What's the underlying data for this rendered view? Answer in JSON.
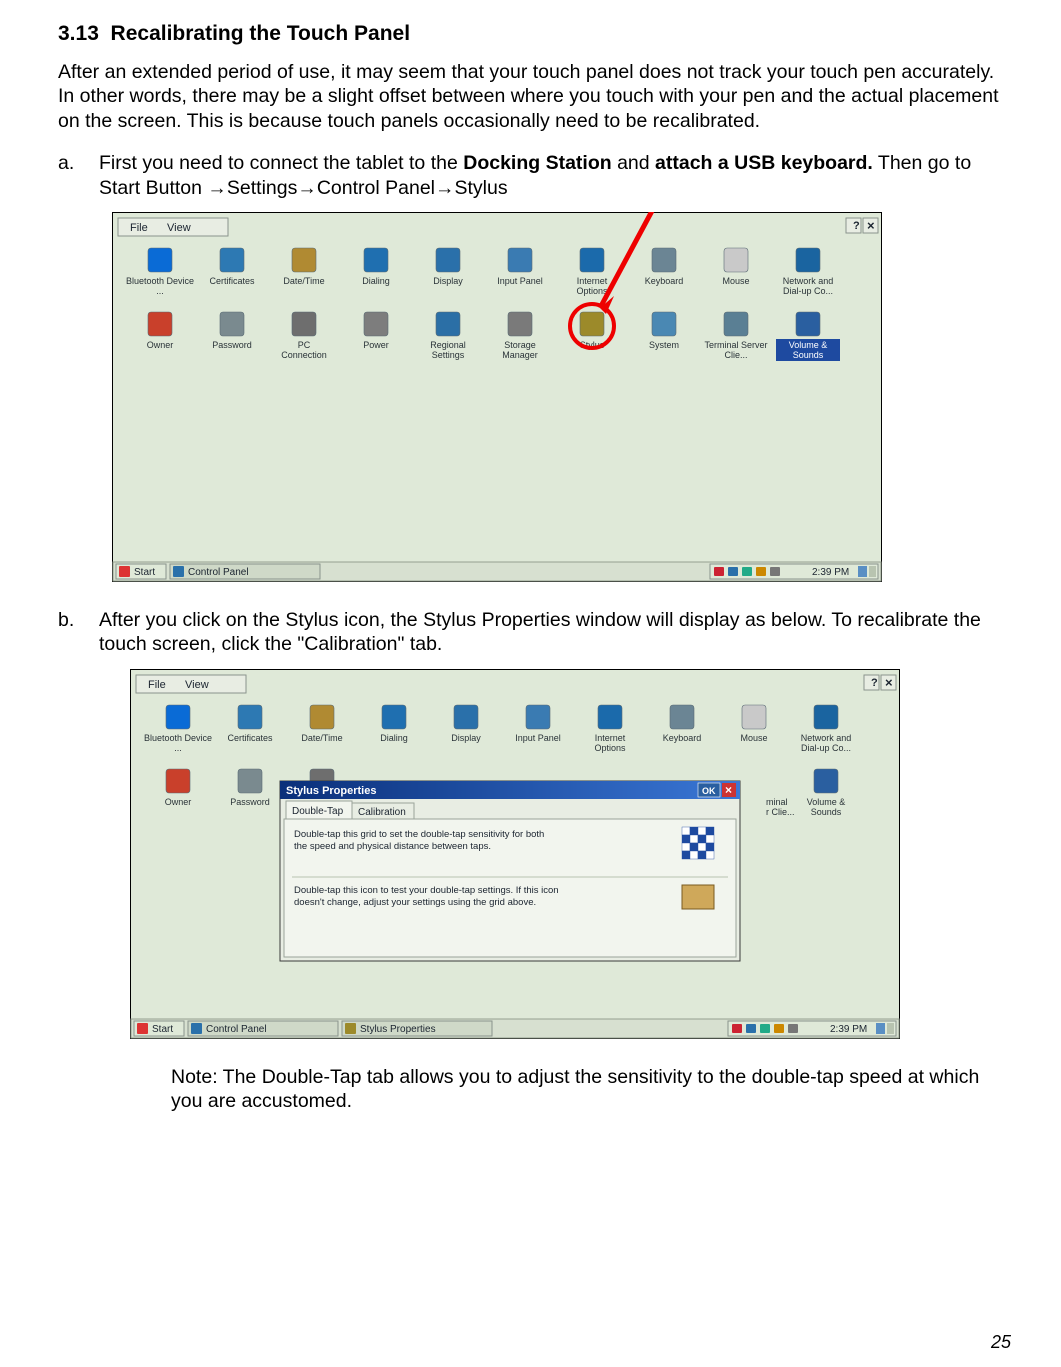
{
  "section_number": "3.13",
  "section_title": "Recalibrating the Touch Panel",
  "intro": "After an extended period of use, it may seem that your touch panel does not track your touch pen accurately.  In other words, there may be a slight offset between where you touch with your pen and the actual placement on the screen.  This is because touch panels occasionally need to be recalibrated.",
  "step_a_marker": "a.",
  "step_a_prefix": "First you need to connect the tablet to the ",
  "step_a_bold1": "Docking Station",
  "step_a_mid": " and ",
  "step_a_bold2": "attach a USB keyboard.",
  "step_a_suffix": "  Then go to Start Button →Settings→Control Panel→Stylus",
  "step_b_marker": "b.",
  "step_b_text": "After you click on the Stylus icon, the Stylus Properties window will display as below.  To recalibrate the touch screen, click the \"Calibration\" tab.",
  "note_text": "Note: The Double-Tap tab allows you to adjust the sensitivity to the double-tap speed at which you are accustomed.",
  "page_number": "25",
  "screenshot1": {
    "menu_file": "File",
    "menu_view": "View",
    "help_glyph": "?",
    "close_glyph": "×",
    "icons_row1": [
      {
        "name": "bluetooth-icon",
        "label": "Bluetooth Device ...",
        "c": "#0a6bd6"
      },
      {
        "name": "certificates-icon",
        "label": "Certificates",
        "c": "#2d79b3"
      },
      {
        "name": "datetime-icon",
        "label": "Date/Time",
        "c": "#b08a32"
      },
      {
        "name": "dialing-icon",
        "label": "Dialing",
        "c": "#1f6fb0"
      },
      {
        "name": "display-icon",
        "label": "Display",
        "c": "#2a70aa"
      },
      {
        "name": "input-panel-icon",
        "label": "Input Panel",
        "c": "#3a7bb2"
      },
      {
        "name": "internet-options-icon",
        "label": "Internet Options",
        "c": "#1b6aab"
      },
      {
        "name": "keyboard-icon",
        "label": "Keyboard",
        "c": "#6b8594"
      },
      {
        "name": "mouse-icon",
        "label": "Mouse",
        "c": "#c9c9c9"
      },
      {
        "name": "network-icon",
        "label": "Network and Dial-up Co...",
        "c": "#1a64a0"
      }
    ],
    "icons_row2": [
      {
        "name": "owner-icon",
        "label": "Owner",
        "c": "#c9402b"
      },
      {
        "name": "password-icon",
        "label": "Password",
        "c": "#7a8a8f"
      },
      {
        "name": "pc-connection-icon",
        "label": "PC Connection",
        "c": "#6e6e6e"
      },
      {
        "name": "power-icon",
        "label": "Power",
        "c": "#7d7d7d"
      },
      {
        "name": "regional-settings-icon",
        "label": "Regional Settings",
        "c": "#2b6fa6"
      },
      {
        "name": "storage-manager-icon",
        "label": "Storage Manager",
        "c": "#7a7a7a"
      },
      {
        "name": "stylus-icon",
        "label": "Stylus",
        "c": "#9c8a2a"
      },
      {
        "name": "system-icon",
        "label": "System",
        "c": "#4a88b3"
      },
      {
        "name": "terminal-server-icon",
        "label": "Terminal Server Clie...",
        "c": "#5a7f94"
      },
      {
        "name": "volume-sounds-icon",
        "label": "Volume & Sounds",
        "c": "#2a5fa0",
        "selected": true
      }
    ],
    "taskbar_start": "Start",
    "taskbar_item": "Control Panel",
    "taskbar_time": "2:39 PM"
  },
  "screenshot2": {
    "menu_file": "File",
    "menu_view": "View",
    "help_glyph": "?",
    "close_glyph": "×",
    "icons_row1": [
      {
        "name": "bluetooth-icon",
        "label": "Bluetooth Device ...",
        "c": "#0a6bd6"
      },
      {
        "name": "certificates-icon",
        "label": "Certificates",
        "c": "#2d79b3"
      },
      {
        "name": "datetime-icon",
        "label": "Date/Time",
        "c": "#b08a32"
      },
      {
        "name": "dialing-icon",
        "label": "Dialing",
        "c": "#1f6fb0"
      },
      {
        "name": "display-icon",
        "label": "Display",
        "c": "#2a70aa"
      },
      {
        "name": "input-panel-icon",
        "label": "Input Panel",
        "c": "#3a7bb2"
      },
      {
        "name": "internet-options-icon",
        "label": "Internet Options",
        "c": "#1b6aab"
      },
      {
        "name": "keyboard-icon",
        "label": "Keyboard",
        "c": "#6b8594"
      },
      {
        "name": "mouse-icon",
        "label": "Mouse",
        "c": "#c9c9c9"
      },
      {
        "name": "network-icon",
        "label": "Network and Dial-up Co...",
        "c": "#1a64a0"
      }
    ],
    "icons_row2": [
      {
        "name": "owner-icon",
        "label": "Owner",
        "c": "#c9402b"
      },
      {
        "name": "password-icon",
        "label": "Password",
        "c": "#7a8a8f"
      },
      {
        "name": "pc-connection-icon",
        "label": "",
        "c": "#6e6e6e"
      },
      {
        "name": "volume-sounds-icon",
        "label": "Volume & Sounds",
        "c": "#2a5fa0"
      }
    ],
    "dialog_title": "Stylus Properties",
    "dialog_ok": "OK",
    "dialog_close": "×",
    "tab_doubletap": "Double-Tap",
    "tab_calibration": "Calibration",
    "dlg_text1": "Double-tap this grid to set the double-tap sensitivity for both the speed and physical distance between taps.",
    "dlg_text2": "Double-tap this icon to test your double-tap settings. If this icon doesn't change, adjust your settings using the grid above.",
    "taskbar_start": "Start",
    "taskbar_item1": "Control Panel",
    "taskbar_item2": "Stylus Properties",
    "taskbar_time": "2:39 PM",
    "hidden_label_terminal": "minal r Clie..."
  }
}
